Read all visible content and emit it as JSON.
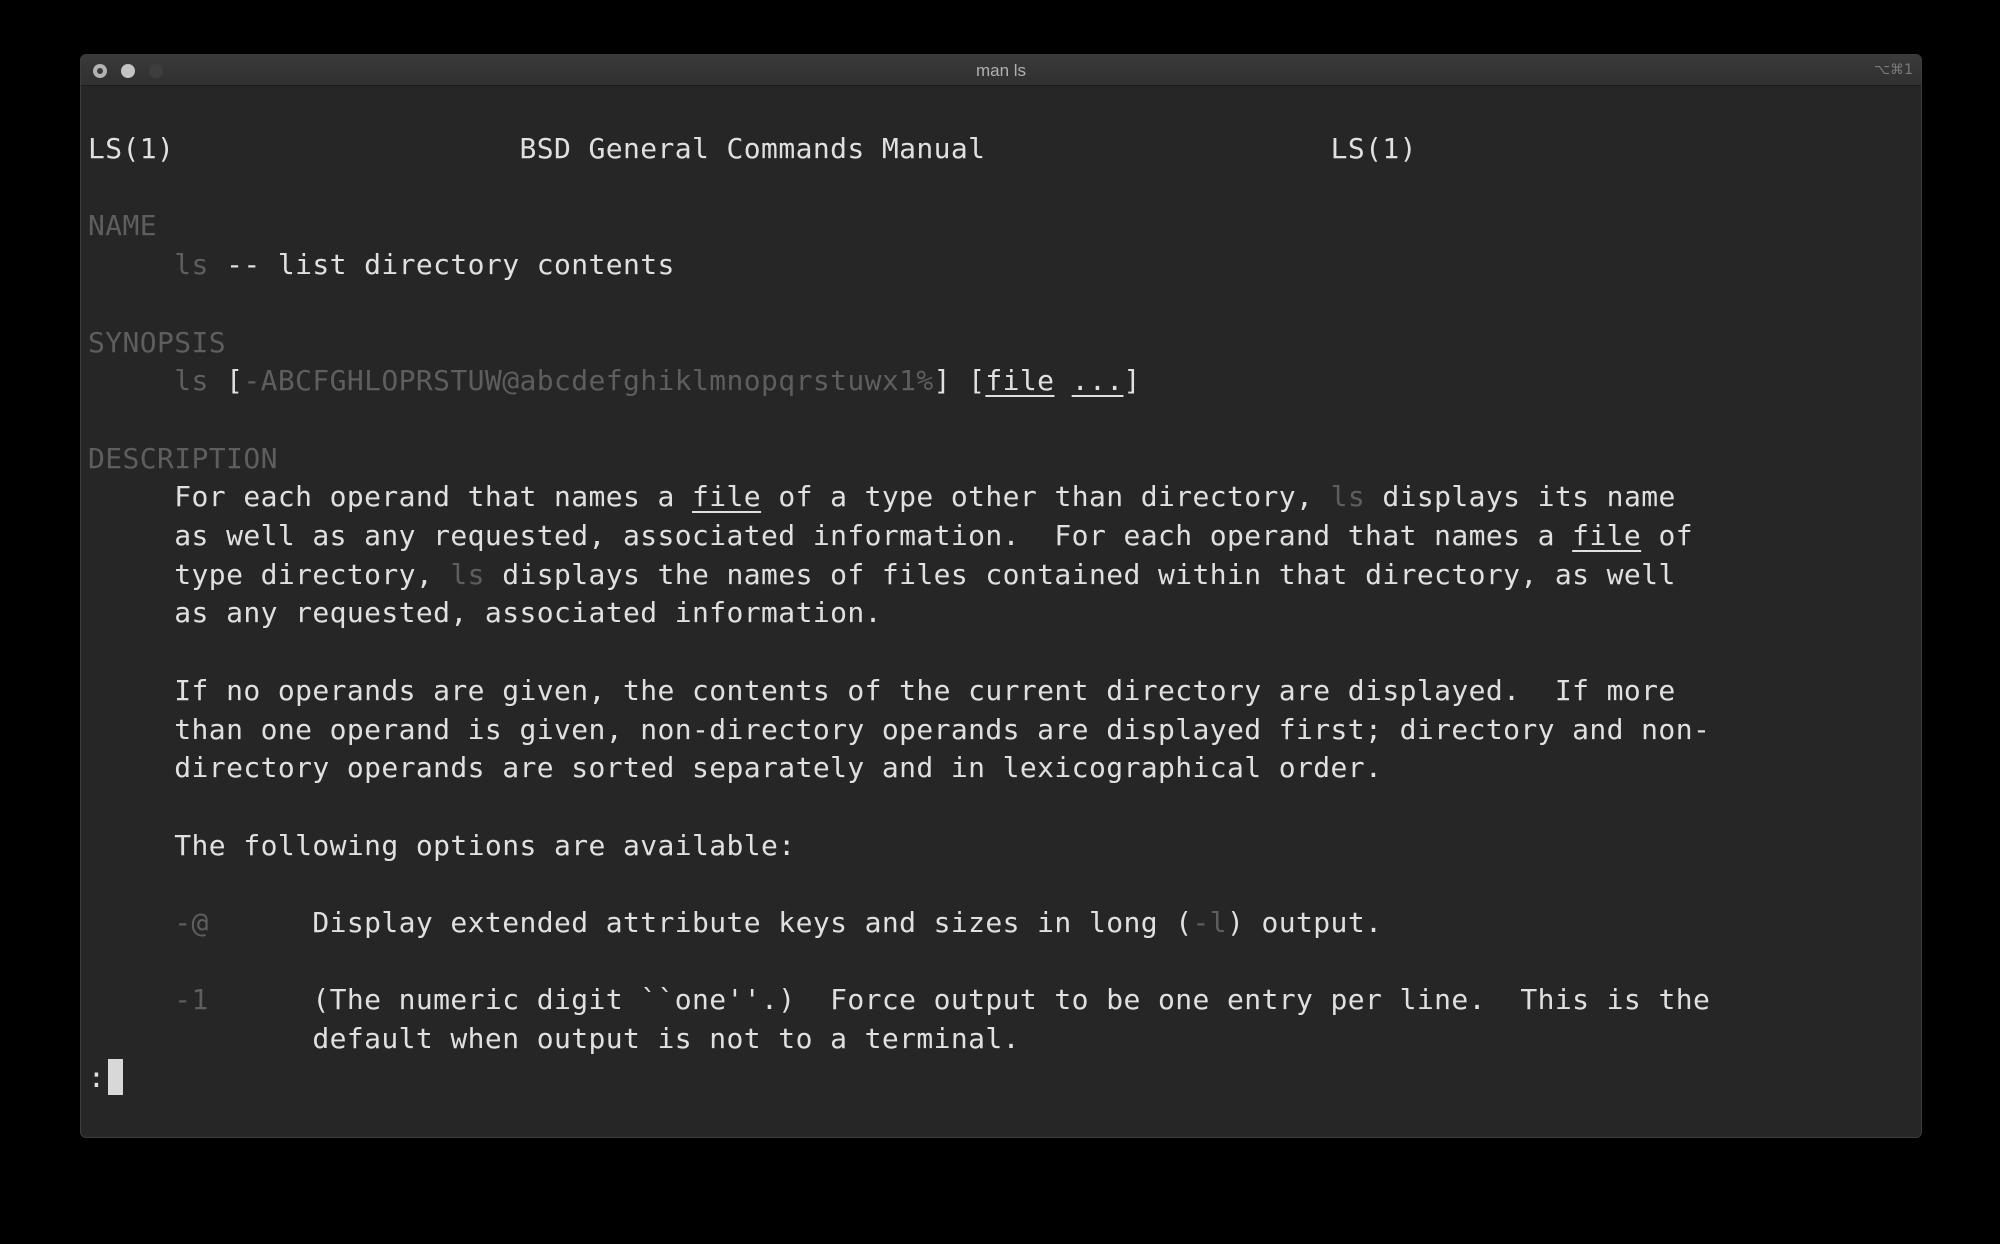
{
  "window": {
    "title": "man ls",
    "shortcut": "⌥⌘1"
  },
  "header": {
    "left": "LS(1)",
    "center": "BSD General Commands Manual",
    "right": "LS(1)"
  },
  "name": {
    "heading": "NAME",
    "command": "ls",
    "summary": " -- list directory contents"
  },
  "synopsis": {
    "heading": "SYNOPSIS",
    "command": "ls",
    "bracket_open": " [",
    "flags": "-ABCFGHLOPRSTUW@abcdefghiklmnopqrstuwx1%",
    "bracket_mid": "] [",
    "file_arg": "file",
    "ellipsis": "...",
    "bracket_close": "]"
  },
  "description": {
    "heading": "DESCRIPTION",
    "p1": {
      "t1": "For each operand that names a ",
      "file1": "file",
      "t2": " of a type other than directory, ",
      "ls1": "ls",
      "t3": " displays its name",
      "line2a": "as well as any requested, associated information.  For each operand that names a ",
      "file2": "file",
      "t4": " of",
      "t5": "type directory, ",
      "ls2": "ls",
      "t6": " displays the names of files contained within that directory, as well",
      "t7": "as any requested, associated information."
    },
    "p2": [
      "If no operands are given, the contents of the current directory are displayed.  If more",
      "than one operand is given, non-directory operands are displayed first; directory and non-",
      "directory operands are sorted separately and in lexicographical order."
    ],
    "p3": "The following options are available:"
  },
  "options": [
    {
      "flag": "-@",
      "t1": "Display extended attribute keys and sizes in long (",
      "ref": "-l",
      "t2": ") output."
    },
    {
      "flag": "-1",
      "line1": "(The numeric digit ``one''.)  Force output to be one entry per line.  This is the",
      "line2": "default when output is not to a terminal."
    }
  ],
  "prompt": ":"
}
